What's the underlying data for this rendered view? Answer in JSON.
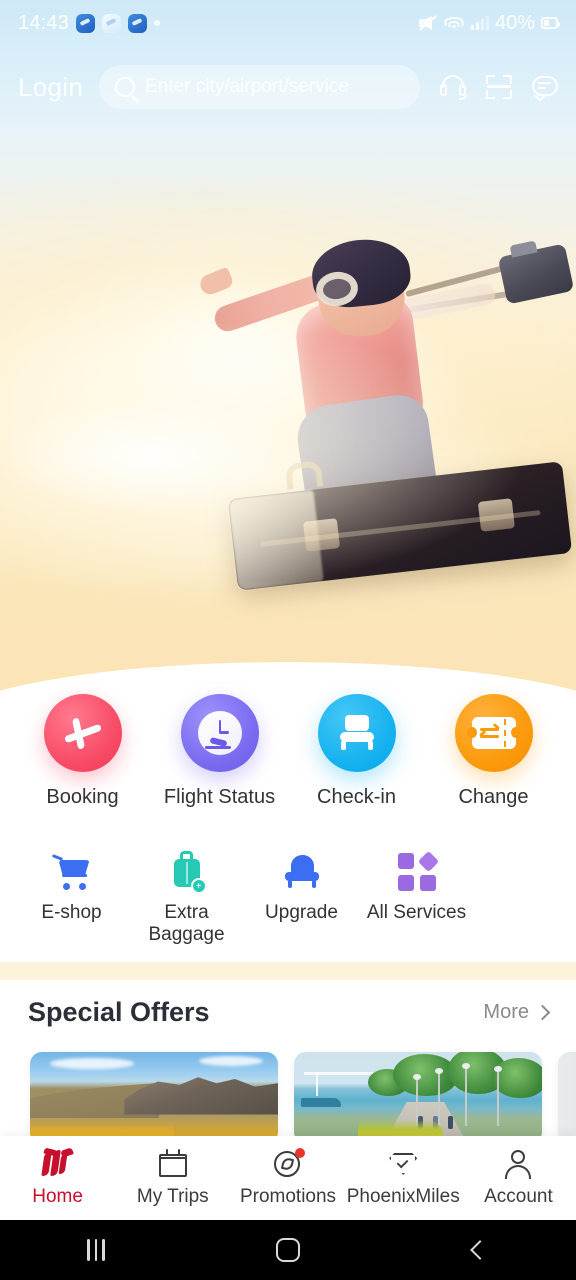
{
  "status_bar": {
    "time": "14:43",
    "battery_percent": "40%",
    "icons": [
      "app-notification-icon",
      "app-notification-icon",
      "app-notification-icon",
      "notification-dot",
      "mute-icon",
      "wifi-icon",
      "signal-icon",
      "battery-icon"
    ]
  },
  "header": {
    "login_label": "Login",
    "search": {
      "placeholder": "Enter city/airport/service",
      "value": ""
    },
    "icons": [
      {
        "name": "headset-icon",
        "label": "Customer Service"
      },
      {
        "name": "scan-icon",
        "label": "Scan"
      },
      {
        "name": "message-icon",
        "label": "Messages"
      }
    ]
  },
  "hero": {
    "description": "Child wearing aviator cap and goggles riding a flying suitcase with a camera against a golden sunset sky"
  },
  "quick_actions": [
    {
      "label": "Booking",
      "icon": "plane-icon",
      "color": "#f84b66"
    },
    {
      "label": "Flight Status",
      "icon": "clock-arrival-icon",
      "color": "#7a6bf0"
    },
    {
      "label": "Check-in",
      "icon": "seat-icon",
      "color": "#16b2ef"
    },
    {
      "label": "Change",
      "icon": "ticket-exchange-icon",
      "color": "#fb9a0c"
    }
  ],
  "services": [
    {
      "label": "E-shop",
      "icon": "cart-icon",
      "color": "#3b6ef0"
    },
    {
      "label": "Extra\nBaggage",
      "label_line1": "Extra",
      "label_line2": "Baggage",
      "icon": "baggage-plus-icon",
      "color": "#25c9b4"
    },
    {
      "label": "Upgrade",
      "icon": "upgrade-seat-icon",
      "color": "#3b6ef0"
    },
    {
      "label": "All Services",
      "icon": "grid-icon",
      "color": "#9b6ae0"
    }
  ],
  "special_offers": {
    "title": "Special Offers",
    "more_label": "More",
    "cards": [
      {
        "name": "offer-card-mountain",
        "alt": "Rocky hillside with golden autumn grass under blue sky"
      },
      {
        "name": "offer-card-seaside",
        "alt": "Seaside promenade with trees, lamp posts and a bridge"
      },
      {
        "name": "offer-card-partial",
        "alt": "Partially visible third offer card"
      }
    ]
  },
  "bottom_nav": {
    "active": "Home",
    "items": [
      {
        "label": "Home",
        "icon": "phoenix-logo-icon",
        "active": true,
        "badge": false
      },
      {
        "label": "My Trips",
        "icon": "calendar-icon",
        "active": false,
        "badge": false
      },
      {
        "label": "Promotions",
        "icon": "compass-icon",
        "active": false,
        "badge": true
      },
      {
        "label": "PhoenixMiles",
        "icon": "diamond-icon",
        "active": false,
        "badge": false
      },
      {
        "label": "Account",
        "icon": "person-icon",
        "active": false,
        "badge": false
      }
    ]
  },
  "android_nav": {
    "recents": "recents-icon",
    "home": "home-icon",
    "back": "back-icon"
  },
  "colors": {
    "brand_red": "#c8102e",
    "badge_red": "#e8342b",
    "hero_top": "#cfe9f7",
    "hero_bottom": "#fbe5b8",
    "divider": "#fdf3da"
  }
}
